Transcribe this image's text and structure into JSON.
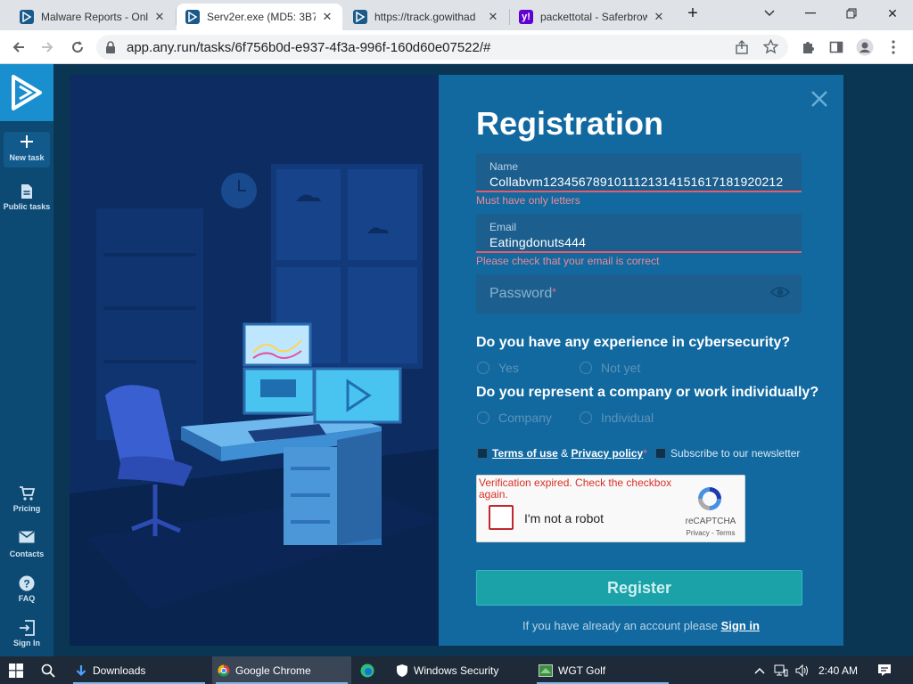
{
  "browser": {
    "tabs": [
      {
        "title": "Malware Reports - Onl"
      },
      {
        "title": "Serv2er.exe (MD5: 3B7"
      },
      {
        "title": "https://track.gowithad"
      },
      {
        "title": "packettotal - Saferbrow"
      }
    ],
    "url": "app.any.run/tasks/6f756b0d-e937-4f3a-996f-160d60e07522/#"
  },
  "sidebar": {
    "new_task": "New task",
    "public_tasks": "Public tasks",
    "pricing": "Pricing",
    "contacts": "Contacts",
    "faq": "FAQ",
    "sign_in": "Sign In"
  },
  "registration": {
    "title": "Registration",
    "name_label": "Name",
    "name_value": "Collabvm1234567891011121314151617181920212",
    "name_error": "Must have only letters",
    "email_label": "Email",
    "email_value": "Eatingdonuts444",
    "email_error": "Please check that your email is correct",
    "password_placeholder": "Password",
    "password_required_mark": "*",
    "q1": "Do you have any experience in cybersecurity?",
    "q1_options": [
      "Yes",
      "Not yet"
    ],
    "q2": "Do you represent a company or work individually?",
    "q2_options": [
      "Company",
      "Individual"
    ],
    "terms_of_use": "Terms of use",
    "amp": "&",
    "privacy_policy": "Privacy policy",
    "required_mark": "*",
    "newsletter": "Subscribe to our newsletter",
    "captcha": {
      "message": "Verification expired. Check the checkbox again.",
      "label": "I'm not a robot",
      "brand": "reCAPTCHA",
      "links": "Privacy - Terms"
    },
    "register_button": "Register",
    "signin_prompt": "If you have already an account please",
    "signin_link": "Sign in"
  },
  "taskbar": {
    "items": [
      "Downloads",
      "Google Chrome",
      "Windows Security",
      "WGT Golf"
    ],
    "clock": "2:40 AM"
  },
  "colors": {
    "accent": "#1169a0",
    "error": "#e35d6a",
    "register": "#1aa2a8"
  }
}
